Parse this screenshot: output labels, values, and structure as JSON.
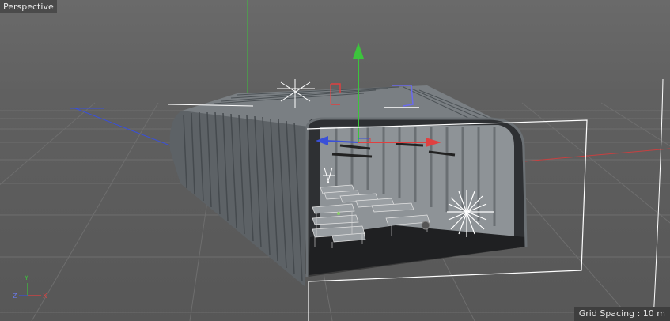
{
  "viewport": {
    "view_label": "Perspective",
    "grid_spacing_label": "Grid Spacing : 10 m",
    "axis_letters": {
      "y": "Y",
      "z": "Z",
      "x": "X"
    }
  },
  "colors": {
    "background": "#606060",
    "grid_line": "#707070",
    "axis_red": "#e04040",
    "axis_green": "#3cc43c",
    "axis_blue": "#3a50d8",
    "selection_frame": "#ffffff"
  }
}
